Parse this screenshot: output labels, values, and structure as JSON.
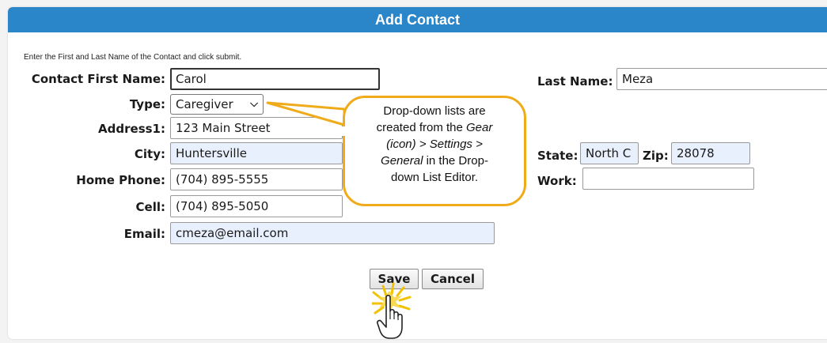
{
  "form": {
    "title": "Add Contact",
    "instruction": "Enter the First and Last Name of the Contact and click submit.",
    "first_name": {
      "label": "Contact First Name:",
      "value": "Carol"
    },
    "last_name": {
      "label": "Last Name:",
      "value": "Meza"
    },
    "type": {
      "label": "Type:",
      "value": "Caregiver"
    },
    "address1": {
      "label": "Address1:",
      "value": "123 Main Street"
    },
    "city": {
      "label": "City:",
      "value": "Huntersville"
    },
    "state": {
      "label": "State:",
      "value": "North C"
    },
    "zip": {
      "label": "Zip:",
      "value": "28078"
    },
    "home_phone": {
      "label": "Home Phone:",
      "value": "(704) 895-5555"
    },
    "work": {
      "label": "Work:",
      "value": ""
    },
    "cell": {
      "label": "Cell:",
      "value": "(704) 895-5050"
    },
    "email": {
      "label": "Email:",
      "value": "cmeza@email.com"
    },
    "save_label": "Save",
    "cancel_label": "Cancel"
  },
  "callout": {
    "line1": "Drop-down lists are",
    "line2_pre": "created from the ",
    "line2_italic": "Gear",
    "line3_italic": "(icon) > Settings >",
    "line4_italic": "General",
    "line4_post": " in the Drop-",
    "line5": "down List Editor."
  },
  "colors": {
    "title_bar": "#2a85c9",
    "callout_border": "#f0ab1a",
    "filled_field": "#e8f0fe"
  },
  "icons": [
    "chevron-down-icon",
    "pointer-hand-icon",
    "click-burst-icon"
  ]
}
